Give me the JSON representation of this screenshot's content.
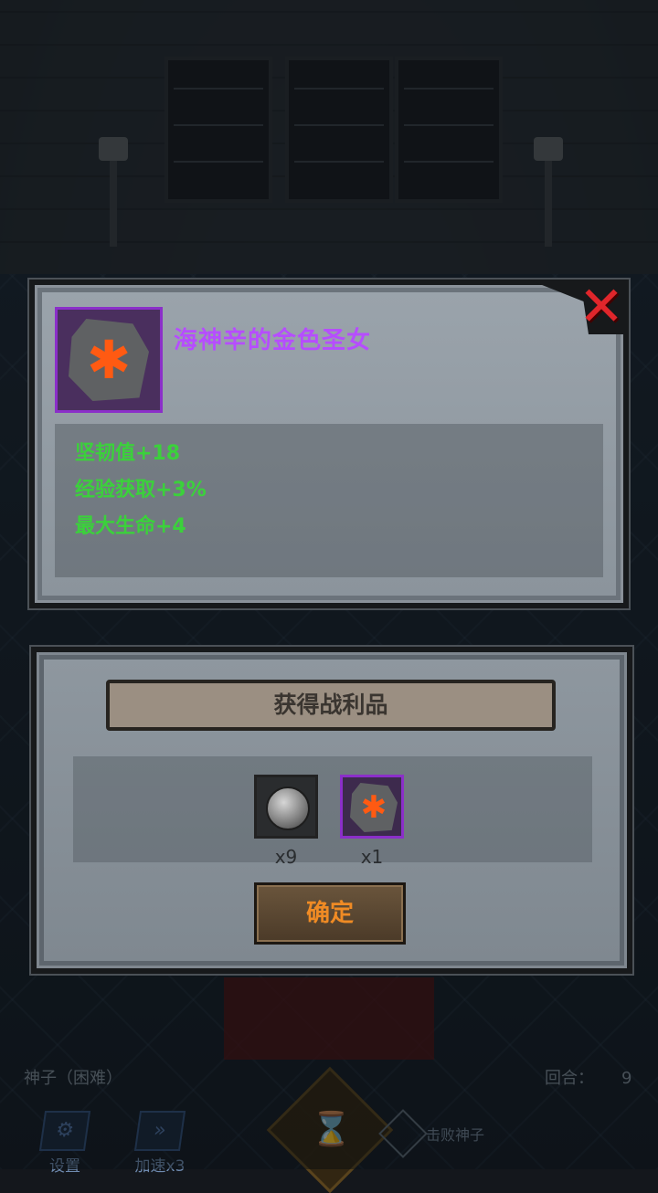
{
  "item": {
    "name": "海神辛的金色圣女",
    "stats": [
      "坚韧值+18",
      "经验获取+3%",
      "最大生命+4"
    ],
    "icon": "rune-stone-icon",
    "rarity_color": "#b64dff"
  },
  "close_icon": "✕",
  "loot": {
    "title": "获得战利品",
    "items": [
      {
        "icon": "silver-coin-icon",
        "qty": "x9"
      },
      {
        "icon": "rune-stone-icon",
        "qty": "x1"
      }
    ],
    "confirm_label": "确定"
  },
  "hud": {
    "stage_label": "神子（困难）",
    "turn_label": "回合：",
    "turn_value": "9",
    "settings_label": "设置",
    "speed_label": "加速x3",
    "defeat_label": "击败神子"
  },
  "colors": {
    "stat_green": "#3bd13b",
    "close_red": "#e0262b",
    "confirm_orange": "#f08b24"
  }
}
